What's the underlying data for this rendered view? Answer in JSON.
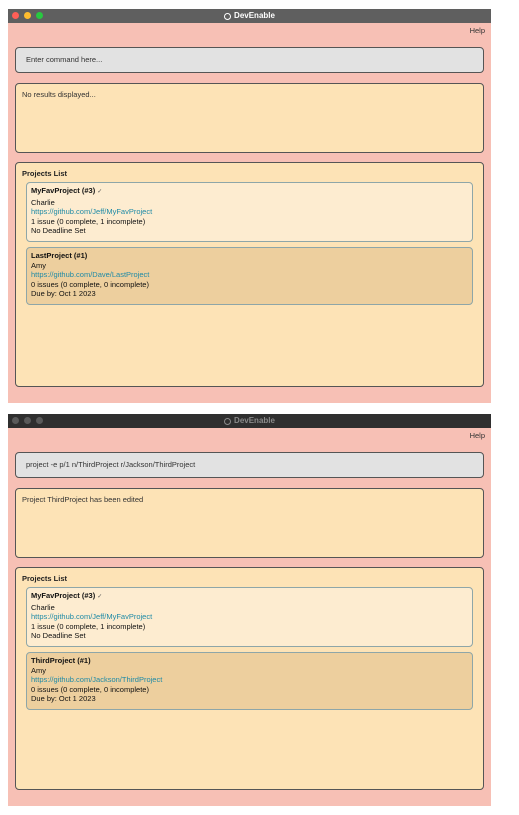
{
  "windows": [
    {
      "title": "DevEnable",
      "menu": {
        "help_label": "Help"
      },
      "command": {
        "text": "Enter command here..."
      },
      "result": {
        "text": "No results displayed..."
      },
      "projects": {
        "title": "Projects List",
        "items": [
          {
            "name": "MyFavProject (#3)",
            "done_mark": "✓",
            "assignee": "Charlie",
            "repo": "https://github.com/Jeff/MyFavProject",
            "issues": "1 issue (0 complete, 1 incomplete)",
            "deadline": "No Deadline Set"
          },
          {
            "name": "LastProject (#1)",
            "done_mark": "",
            "assignee": "Amy",
            "repo": "https://github.com/Dave/LastProject",
            "issues": "0 issues (0 complete, 0 incomplete)",
            "deadline": "Due by: Oct 1 2023"
          }
        ]
      }
    },
    {
      "title": "DevEnable",
      "menu": {
        "help_label": "Help"
      },
      "command": {
        "text": "project -e p/1 n/ThirdProject r/Jackson/ThirdProject"
      },
      "result": {
        "text": "Project ThirdProject has been edited"
      },
      "projects": {
        "title": "Projects List",
        "items": [
          {
            "name": "MyFavProject (#3)",
            "done_mark": "✓",
            "assignee": "Charlie",
            "repo": "https://github.com/Jeff/MyFavProject",
            "issues": "1 issue (0 complete, 1 incomplete)",
            "deadline": "No Deadline Set"
          },
          {
            "name": "ThirdProject (#1)",
            "done_mark": "",
            "assignee": "Amy",
            "repo": "https://github.com/Jackson/ThirdProject",
            "issues": "0 issues (0 complete, 0 incomplete)",
            "deadline": "Due by: Oct 1 2023"
          }
        ]
      }
    }
  ]
}
